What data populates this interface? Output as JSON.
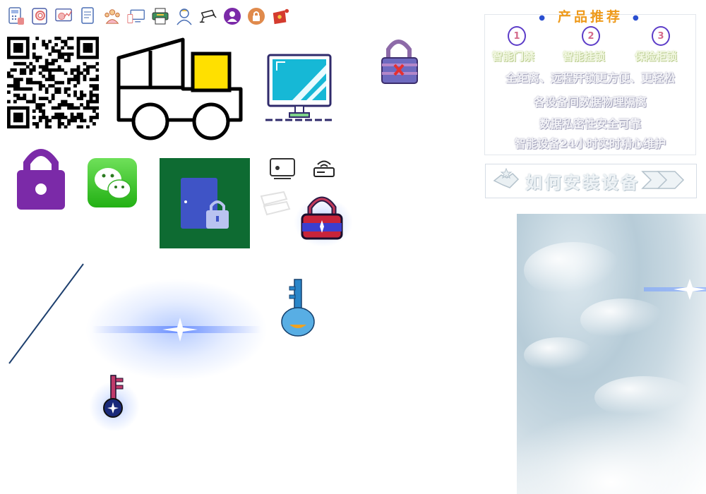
{
  "toolbar_icons": [
    {
      "name": "calculator-icon",
      "color": "#6c8ec9"
    },
    {
      "name": "fingerprint-card-icon",
      "color": "#e06c6c"
    },
    {
      "name": "analytics-icon",
      "color": "#e06c6c"
    },
    {
      "name": "document-icon",
      "color": "#4a6fb5"
    },
    {
      "name": "team-icon",
      "color": "#e08a4c"
    },
    {
      "name": "devices-icon",
      "color": "#4a6fb5"
    },
    {
      "name": "printer-icon",
      "color": "#3d8f5b"
    },
    {
      "name": "user-icon",
      "color": "#4a6fb5"
    },
    {
      "name": "cctv-camera-icon",
      "color": "#222222"
    },
    {
      "name": "person-badge-icon",
      "color": "#7b2aa8"
    },
    {
      "name": "lock-badge-icon",
      "color": "#e08a4c"
    },
    {
      "name": "red-package-icon",
      "color": "#d43b2e"
    }
  ],
  "panel": {
    "title": "产品推荐",
    "numbers": [
      "1",
      "2",
      "3"
    ],
    "features": [
      "智能门禁",
      "智能挂锁",
      "保险柜锁"
    ],
    "lines": [
      "全距离、远程开锁更方便、更轻松",
      "各设备间数据物理隔离",
      "数据私密性安全可靠",
      "智能设备24小时实时精心维护"
    ]
  },
  "install": {
    "label": "如何安装设备"
  },
  "colors": {
    "title_orange": "#ee9a1b",
    "lock_purple": "#7b2aa8",
    "wechat_green": "#3cc51f",
    "door_bg": "#0e6b32",
    "monitor_cyan": "#16b8d6",
    "truck_yellow": "#ffe000"
  }
}
